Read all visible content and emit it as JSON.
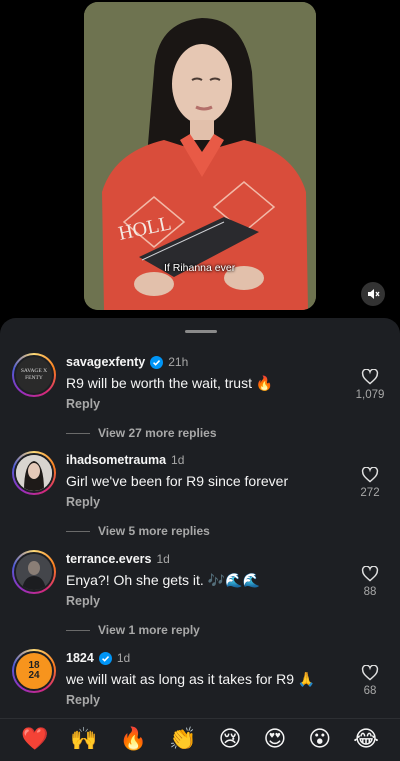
{
  "video": {
    "caption": "If Rihanna ever",
    "shirt_text": "HOLL",
    "mute_icon": "speaker-muted-icon"
  },
  "comments": [
    {
      "username": "savagexfenty",
      "verified": true,
      "time": "21h",
      "text": "R9 will be worth the wait, trust 🔥",
      "reply_label": "Reply",
      "likes": "1,079",
      "view_replies": "View 27 more replies",
      "avatar_text_line1": "SAVAGE X",
      "avatar_text_line2": "FENTY"
    },
    {
      "username": "ihadsometrauma",
      "verified": false,
      "time": "1d",
      "text": "Girl we've been for R9 since forever",
      "reply_label": "Reply",
      "likes": "272",
      "view_replies": "View 5 more replies"
    },
    {
      "username": "terrance.evers",
      "verified": false,
      "time": "1d",
      "text": "Enya?! Oh she gets it. 🎶🌊🌊",
      "reply_label": "Reply",
      "likes": "88",
      "view_replies": "View 1 more reply"
    },
    {
      "username": "1824",
      "verified": true,
      "time": "1d",
      "text": "we will wait as long as it takes for R9 🙏",
      "reply_label": "Reply",
      "likes": "68",
      "avatar_text": "18 24"
    }
  ],
  "emoji_bar": [
    "❤️",
    "🙌",
    "🔥",
    "👏",
    "😢",
    "😍",
    "😮",
    "😂"
  ],
  "colors": {
    "sheet_bg": "#1d1f23",
    "verified_blue": "#0095f6",
    "secondary_text": "#a8a8a8",
    "avatar_1824": "#f7941d"
  }
}
